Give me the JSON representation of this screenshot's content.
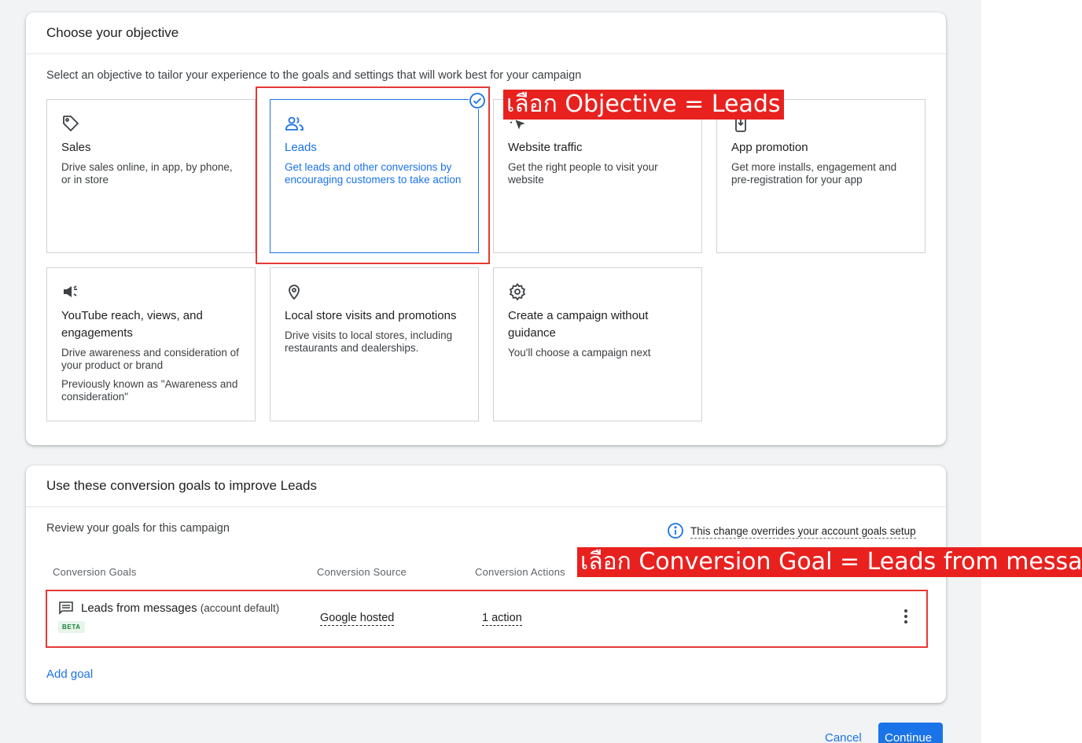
{
  "objective": {
    "title": "Choose your objective",
    "subtitle": "Select an objective to tailor your experience to the goals and settings that will work best for your campaign",
    "cards": [
      {
        "title": "Sales",
        "desc": "Drive sales online, in app, by phone, or in store",
        "icon": "tag-icon",
        "selected": false
      },
      {
        "title": "Leads",
        "desc": "Get leads and other conversions by encouraging customers to take action",
        "icon": "people-icon",
        "selected": true
      },
      {
        "title": "Website traffic",
        "desc": "Get the right people to visit your website",
        "icon": "cursor-click-icon",
        "selected": false
      },
      {
        "title": "App promotion",
        "desc": "Get more installs, engagement and pre-registration for your app",
        "icon": "phone-download-icon",
        "selected": false
      },
      {
        "title": "YouTube reach, views, and engagements",
        "desc": "Drive awareness and consideration of your product or brand",
        "desc2": "Previously known as \"Awareness and consideration\"",
        "icon": "megaphone-icon",
        "selected": false
      },
      {
        "title": "Local store visits and promotions",
        "desc": "Drive visits to local stores, including restaurants and dealerships.",
        "icon": "location-pin-icon",
        "selected": false
      },
      {
        "title": "Create a campaign without guidance",
        "desc": "You'll choose a campaign next",
        "icon": "gear-icon",
        "selected": false
      }
    ]
  },
  "annotations": {
    "objective_label": "เลือก Objective = Leads",
    "goal_label": "เลือก Conversion Goal = Leads from messages"
  },
  "goals": {
    "title": "Use these conversion goals to improve Leads",
    "subtitle": "Review your goals for this campaign",
    "info_text": "This change overrides your account goals setup",
    "columns": [
      "Conversion Goals",
      "Conversion Source",
      "Conversion Actions"
    ],
    "row": {
      "name": "Leads from messages",
      "default_label": "(account default)",
      "badge": "BETA",
      "source": "Google hosted",
      "actions": "1 action"
    },
    "add_goal": "Add goal"
  },
  "footer": {
    "cancel": "Cancel",
    "continue": "Continue"
  },
  "colors": {
    "accent": "#1a73e8",
    "annotation": "#e8211f"
  }
}
